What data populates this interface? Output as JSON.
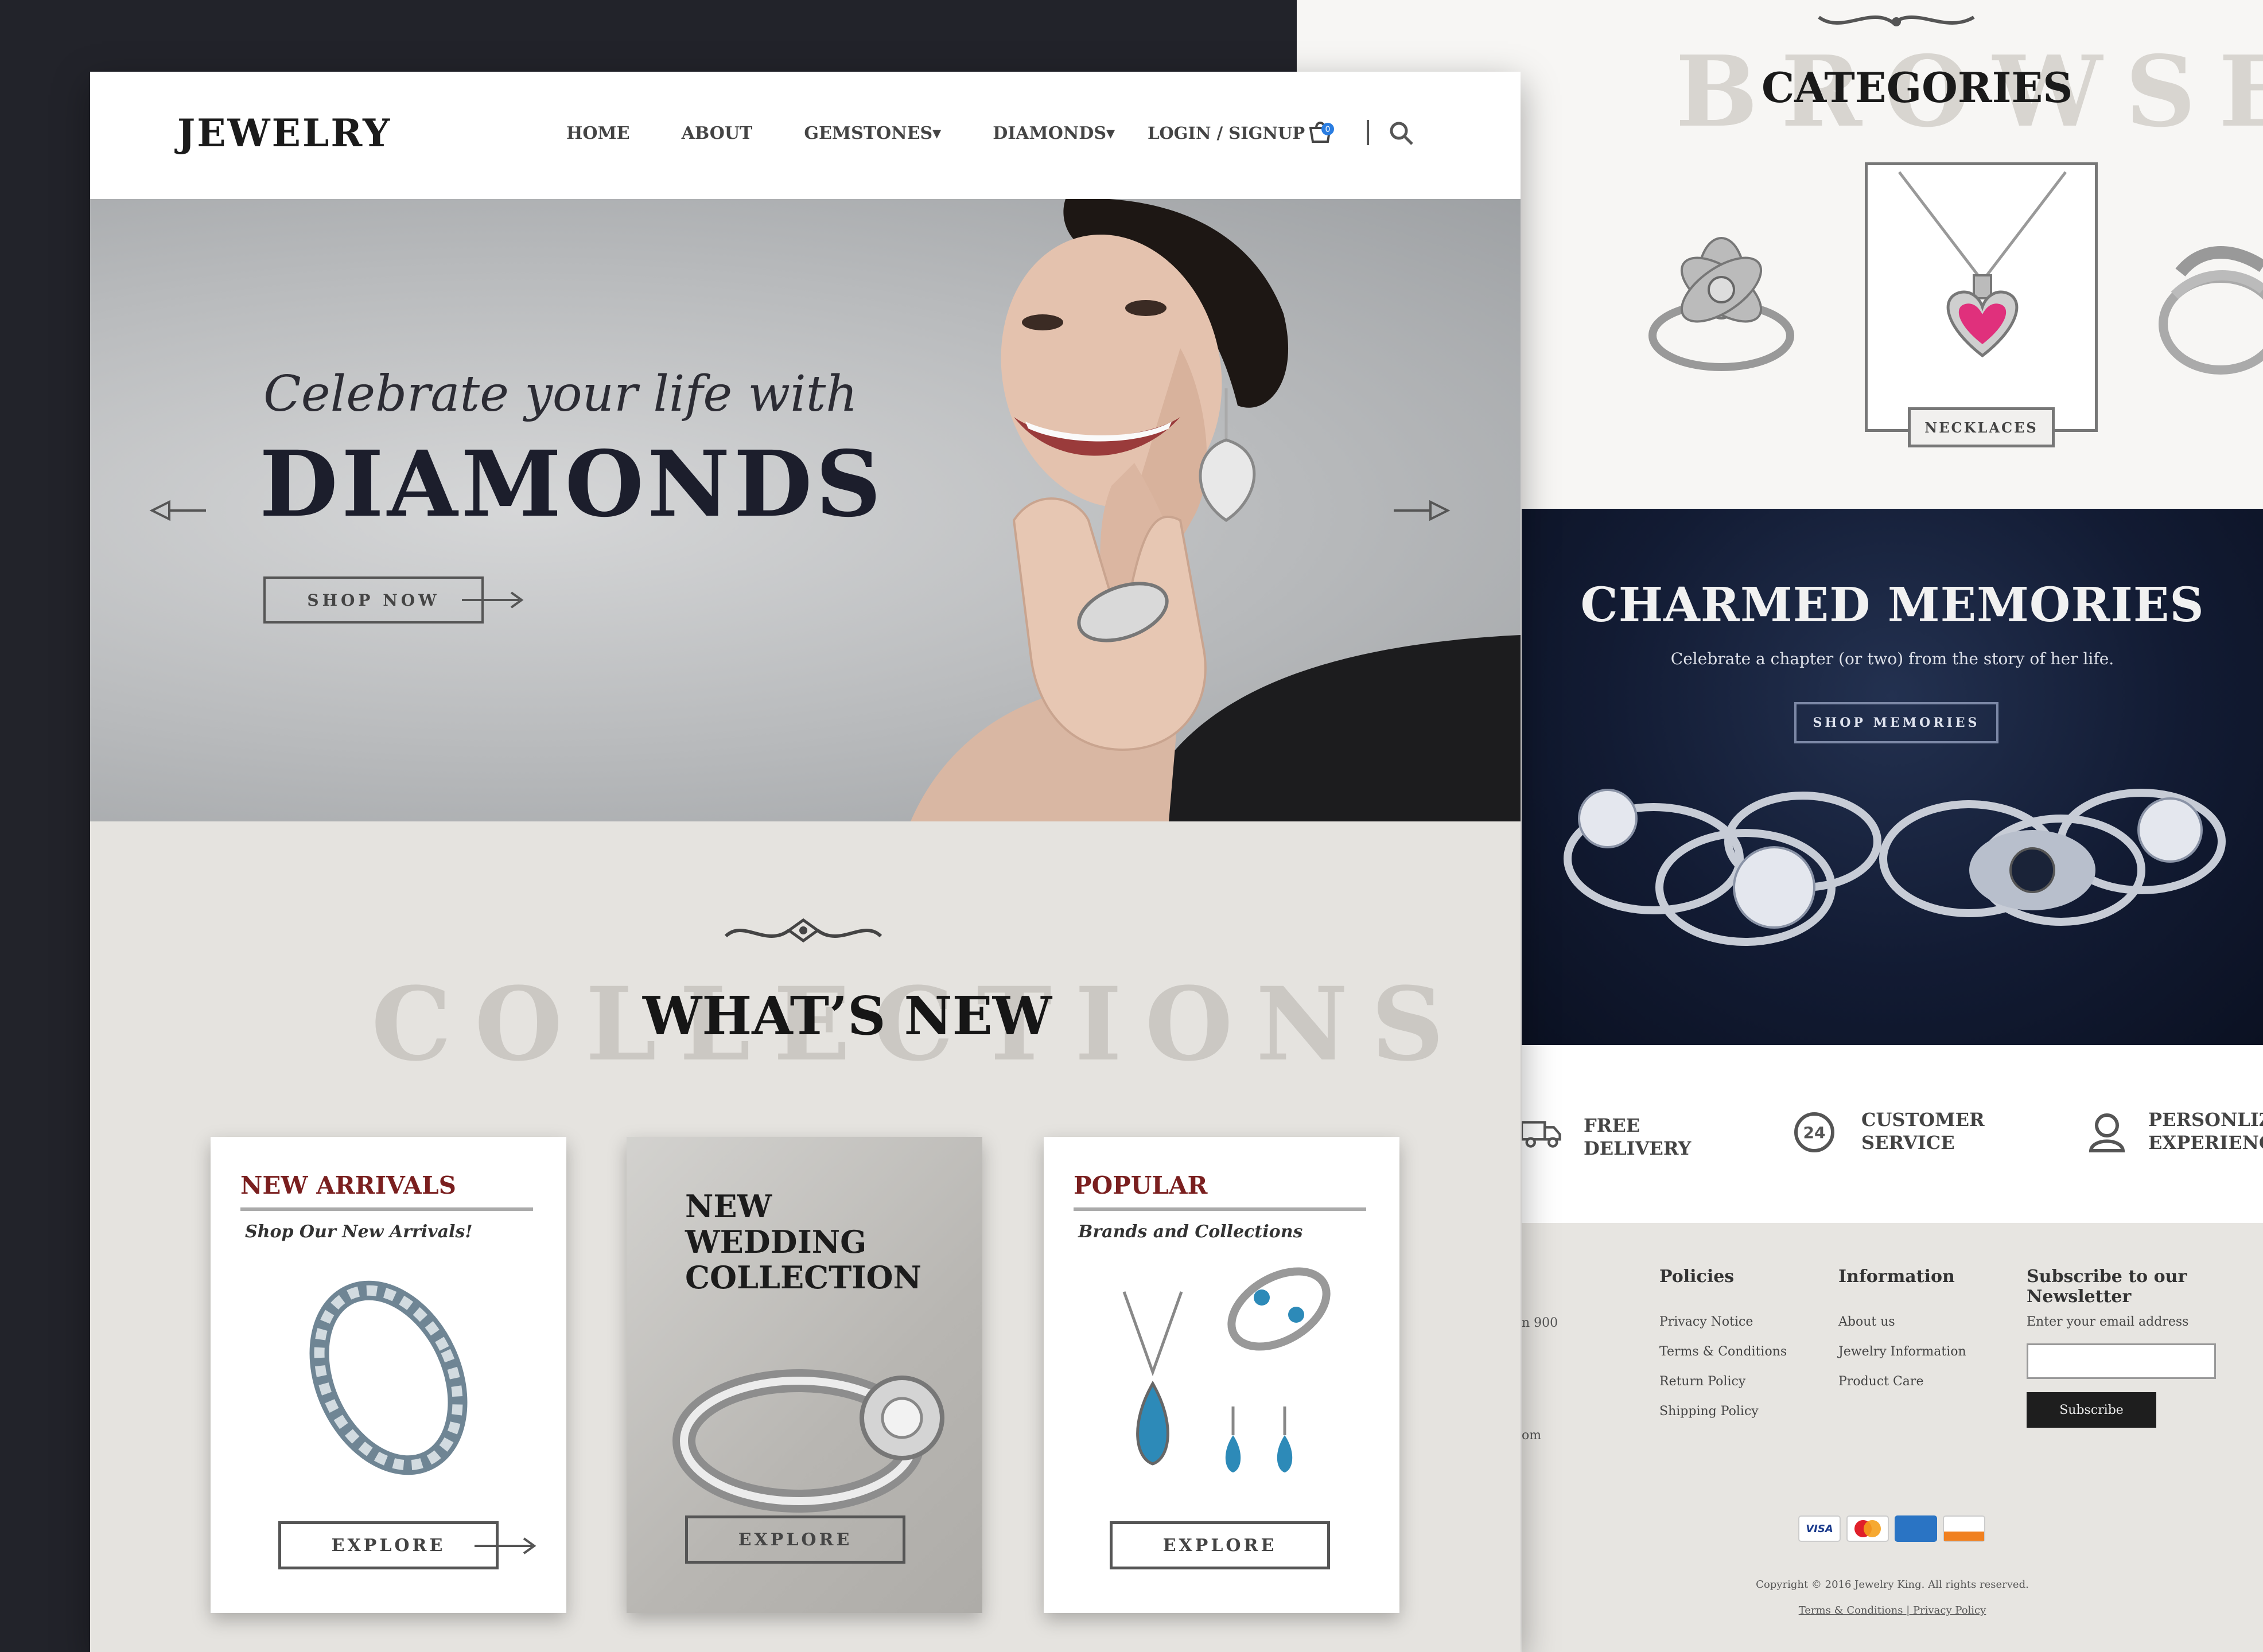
{
  "nav": {
    "logo": "JEWELRY",
    "items": [
      "HOME",
      "ABOUT",
      "GEMSTONES",
      "DIAMONDS"
    ],
    "login": "LOGIN / SIGNUP",
    "cart_count": "0"
  },
  "hero": {
    "script": "Celebrate your life with",
    "title": "DIAMONDS",
    "button": "SHOP NOW"
  },
  "collections": {
    "bg_text": "COLLECTIONS",
    "title": "WHAT’S NEW",
    "cards": [
      {
        "title": "NEW ARRIVALS",
        "subtitle": "Shop Our New Arrivals!",
        "button": "EXPLORE"
      },
      {
        "title": "NEW\nWEDDING\nCOLLECTION",
        "button": "EXPLORE"
      },
      {
        "title": "POPULAR",
        "subtitle": "Brands and Collections",
        "button": "EXPLORE"
      }
    ]
  },
  "browse": {
    "bg_text": "BROWSE",
    "title": "CATEGORIES",
    "active_label": "NECKLACES"
  },
  "charmed": {
    "title": "CHARMED MEMORIES",
    "subtitle": "Celebrate a chapter (or two) from the story of her life.",
    "button": "SHOP MEMORIES"
  },
  "features": [
    {
      "label": "FREE\nDELIVERY",
      "icon": "truck-icon"
    },
    {
      "label": "CUSTOMER\nSERVICE",
      "icon": "support-24-icon"
    },
    {
      "label": "PERSONLIZED\nEXPERIENCE",
      "icon": "person-icon"
    }
  ],
  "footer": {
    "stub_1": "n 900",
    "stub_2": "om",
    "policies_title": "Policies",
    "policies": [
      "Privacy Notice",
      "Terms & Conditions",
      "Return Policy",
      "Shipping Policy"
    ],
    "info_title": "Information",
    "info": [
      "About us",
      "Jewelry Information",
      "Product Care"
    ],
    "newsletter_title": "Subscribe to our Newsletter",
    "newsletter_label": "Enter your email address",
    "subscribe": "Subscribe",
    "payments": [
      "VISA",
      "MC",
      "AMEX",
      "DISCOVER"
    ],
    "copyright": "Copyright © 2016 Jewelry King. All rights reserved.",
    "terms_link": "Terms & Conditions",
    "privacy_link": "Privacy Policy"
  },
  "colors": {
    "accent": "#7a1f1f",
    "navy": "#121b33",
    "dark": "#22232a"
  }
}
